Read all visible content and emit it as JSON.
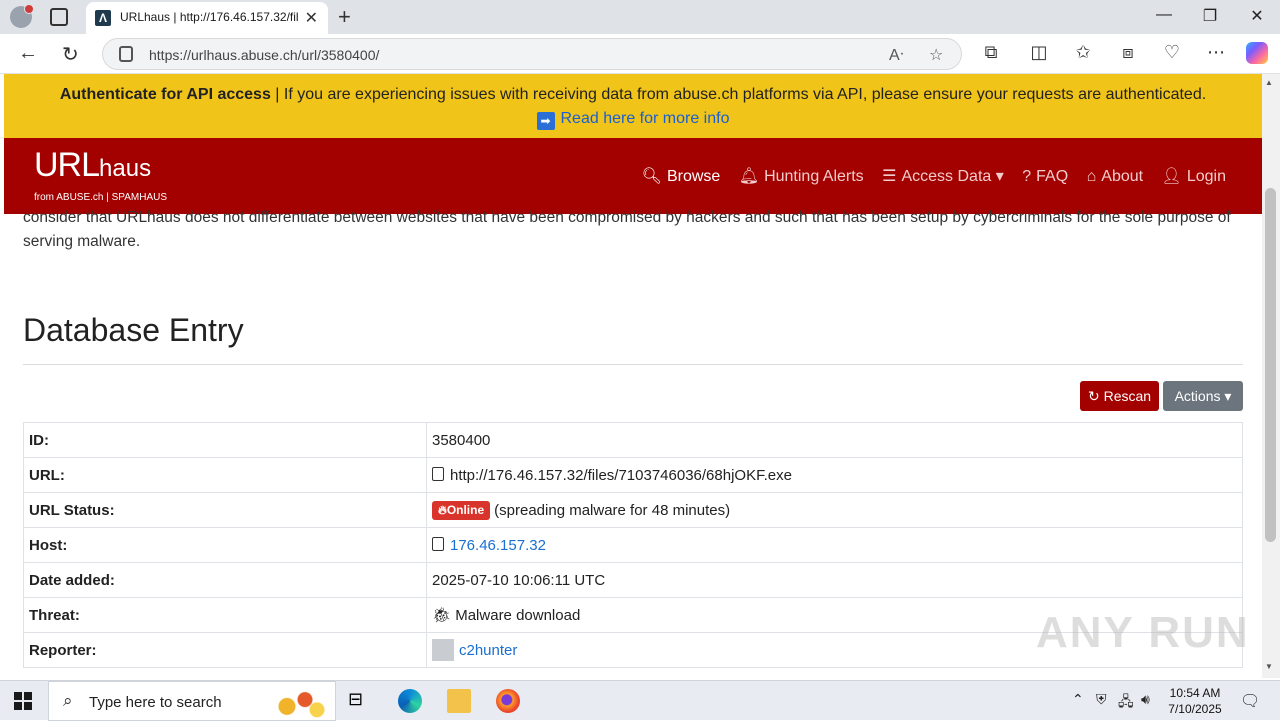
{
  "browser": {
    "tab_title": "URLhaus | http://176.46.157.32/fil",
    "tab_favicon": "Λ",
    "address_url": "https://urlhaus.abuse.ch/url/3580400/"
  },
  "banner": {
    "bold": "Authenticate for API access",
    "text": " | If you are experiencing issues with receiving data from abuse.ch platforms via API, please ensure your requests are authenticated.",
    "link_icon": "➡",
    "link": "Read here for more info"
  },
  "navbar": {
    "logo_main": "URL",
    "logo_suffix": "haus",
    "logo_sub": "from ABUSE.ch | SPAMHAUS",
    "items": [
      {
        "icon": "search-icon",
        "label": "Browse"
      },
      {
        "icon": "bell-icon",
        "label": "Hunting Alerts"
      },
      {
        "icon": "database-icon",
        "label": "Access Data ▾"
      },
      {
        "icon": "question-icon",
        "label": "FAQ"
      },
      {
        "icon": "home-icon",
        "label": "About"
      },
      {
        "icon": "user-icon",
        "label": "Login"
      }
    ]
  },
  "intro_text": "consider that URLhaus does not differentiate between websites that have been compromised by hackers and such that has been setup by cybercriminals for the sole purpose of serving malware.",
  "heading": "Database Entry",
  "buttons": {
    "rescan": "Rescan",
    "actions": "Actions ▾"
  },
  "entry": {
    "id_label": "ID:",
    "id_value": "3580400",
    "url_label": "URL:",
    "url_value": "http://176.46.157.32/files/7103746036/68hjOKF.exe",
    "status_label": "URL Status:",
    "status_badge": "Online",
    "status_text": "(spreading malware for 48 minutes)",
    "host_label": "Host:",
    "host_value": "176.46.157.32",
    "date_label": "Date added:",
    "date_value": "2025-07-10 10:06:11 UTC",
    "threat_label": "Threat:",
    "threat_value": "Malware download",
    "reporter_label": "Reporter:",
    "reporter_value": "c2hunter"
  },
  "watermark": "ANY RUN",
  "taskbar": {
    "search_placeholder": "Type here to search",
    "time": "10:54 AM",
    "date": "7/10/2025"
  },
  "colors": {
    "banner": "#f0c419",
    "navbar": "#a30000",
    "rescan": "#a30000",
    "actions": "#6c757d",
    "online_badge": "#d9342b"
  }
}
